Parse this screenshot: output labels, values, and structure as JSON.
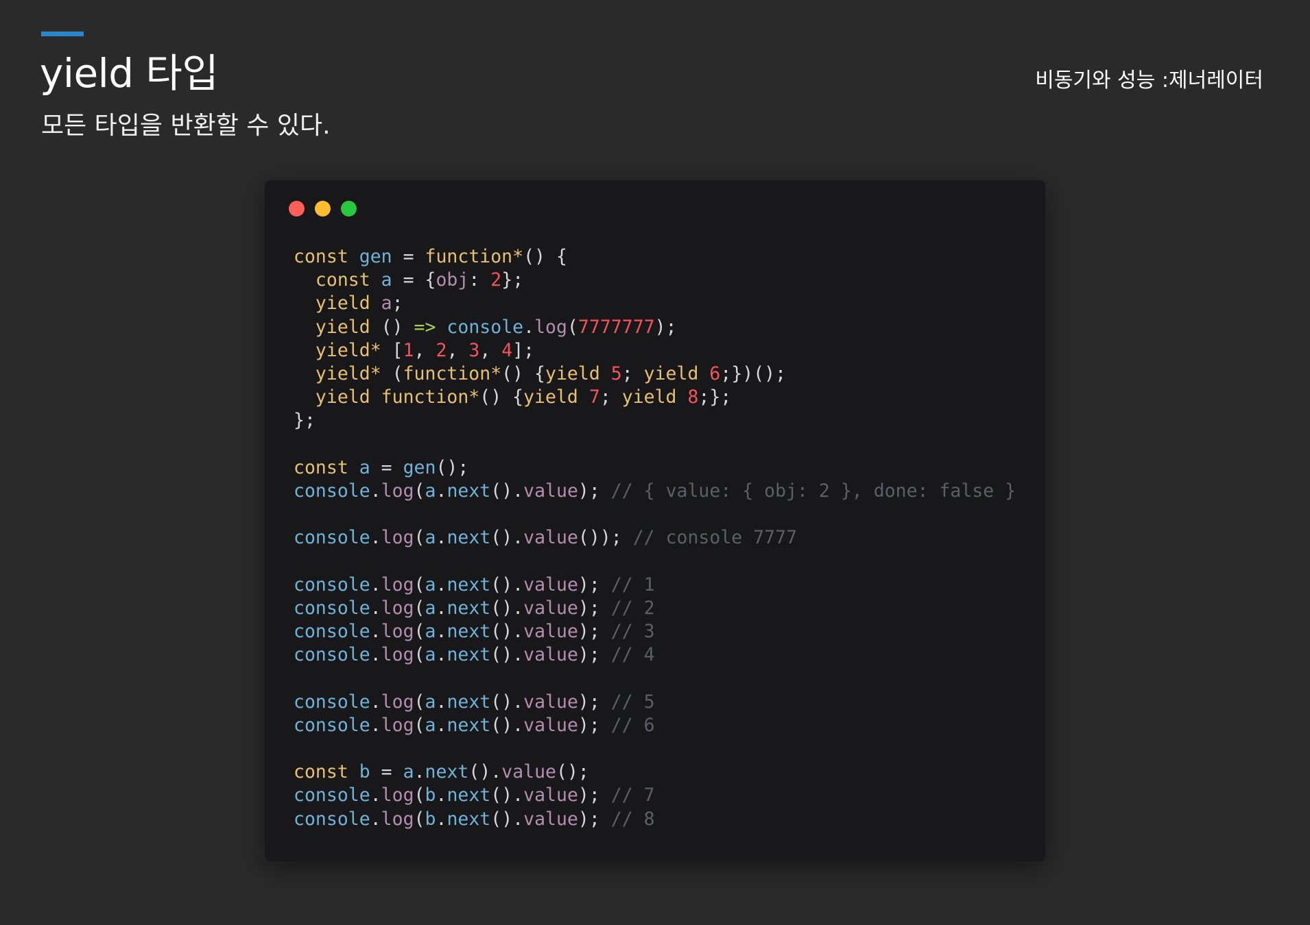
{
  "header": {
    "title": "yield 타입",
    "subtitle": "모든 타입을 반환할 수 있다.",
    "section": "비동기와 성능 :제너레이터"
  },
  "code_lines": [
    [
      [
        "kw",
        "const"
      ],
      [
        "pu",
        " "
      ],
      [
        "vr",
        "gen"
      ],
      [
        "pu",
        " = "
      ],
      [
        "kw",
        "function*"
      ],
      [
        "pu",
        "() {"
      ]
    ],
    [
      [
        "pu",
        "  "
      ],
      [
        "kw",
        "const"
      ],
      [
        "pu",
        " "
      ],
      [
        "vr",
        "a"
      ],
      [
        "pu",
        " = {"
      ],
      [
        "pr",
        "obj"
      ],
      [
        "pu",
        ": "
      ],
      [
        "nm",
        "2"
      ],
      [
        "pu",
        "};"
      ]
    ],
    [
      [
        "pu",
        "  "
      ],
      [
        "kw",
        "yield"
      ],
      [
        "pu",
        " "
      ],
      [
        "pr",
        "a"
      ],
      [
        "pu",
        ";"
      ]
    ],
    [
      [
        "pu",
        "  "
      ],
      [
        "kw",
        "yield"
      ],
      [
        "pu",
        " () "
      ],
      [
        "ar",
        "=>"
      ],
      [
        "pu",
        " "
      ],
      [
        "vr",
        "console"
      ],
      [
        "pu",
        "."
      ],
      [
        "pr",
        "log"
      ],
      [
        "pu",
        "("
      ],
      [
        "nm",
        "7777777"
      ],
      [
        "pu",
        ");"
      ]
    ],
    [
      [
        "pu",
        "  "
      ],
      [
        "kw",
        "yield*"
      ],
      [
        "pu",
        " ["
      ],
      [
        "nm",
        "1"
      ],
      [
        "pu",
        ", "
      ],
      [
        "nm",
        "2"
      ],
      [
        "pu",
        ", "
      ],
      [
        "nm",
        "3"
      ],
      [
        "pu",
        ", "
      ],
      [
        "nm",
        "4"
      ],
      [
        "pu",
        "];"
      ]
    ],
    [
      [
        "pu",
        "  "
      ],
      [
        "kw",
        "yield*"
      ],
      [
        "pu",
        " ("
      ],
      [
        "kw",
        "function*"
      ],
      [
        "pu",
        "() {"
      ],
      [
        "kw",
        "yield"
      ],
      [
        "pu",
        " "
      ],
      [
        "nm",
        "5"
      ],
      [
        "pu",
        "; "
      ],
      [
        "kw",
        "yield"
      ],
      [
        "pu",
        " "
      ],
      [
        "nm",
        "6"
      ],
      [
        "pu",
        ";})();"
      ]
    ],
    [
      [
        "pu",
        "  "
      ],
      [
        "kw",
        "yield"
      ],
      [
        "pu",
        " "
      ],
      [
        "kw",
        "function*"
      ],
      [
        "pu",
        "() {"
      ],
      [
        "kw",
        "yield"
      ],
      [
        "pu",
        " "
      ],
      [
        "nm",
        "7"
      ],
      [
        "pu",
        "; "
      ],
      [
        "kw",
        "yield"
      ],
      [
        "pu",
        " "
      ],
      [
        "nm",
        "8"
      ],
      [
        "pu",
        ";};"
      ]
    ],
    [
      [
        "pu",
        "};"
      ]
    ],
    [],
    [
      [
        "kw",
        "const"
      ],
      [
        "pu",
        " "
      ],
      [
        "vr",
        "a"
      ],
      [
        "pu",
        " = "
      ],
      [
        "vr",
        "gen"
      ],
      [
        "pu",
        "();"
      ]
    ],
    [
      [
        "vr",
        "console"
      ],
      [
        "pu",
        "."
      ],
      [
        "pr",
        "log"
      ],
      [
        "pu",
        "("
      ],
      [
        "vr",
        "a"
      ],
      [
        "pu",
        "."
      ],
      [
        "vr",
        "next"
      ],
      [
        "pu",
        "()."
      ],
      [
        "pr",
        "value"
      ],
      [
        "pu",
        "); "
      ],
      [
        "cm",
        "// { value: { obj: 2 }, done: false }"
      ]
    ],
    [],
    [
      [
        "vr",
        "console"
      ],
      [
        "pu",
        "."
      ],
      [
        "pr",
        "log"
      ],
      [
        "pu",
        "("
      ],
      [
        "vr",
        "a"
      ],
      [
        "pu",
        "."
      ],
      [
        "vr",
        "next"
      ],
      [
        "pu",
        "()."
      ],
      [
        "pr",
        "value"
      ],
      [
        "pu",
        "()); "
      ],
      [
        "cm",
        "// console 7777"
      ]
    ],
    [],
    [
      [
        "vr",
        "console"
      ],
      [
        "pu",
        "."
      ],
      [
        "pr",
        "log"
      ],
      [
        "pu",
        "("
      ],
      [
        "vr",
        "a"
      ],
      [
        "pu",
        "."
      ],
      [
        "vr",
        "next"
      ],
      [
        "pu",
        "()."
      ],
      [
        "pr",
        "value"
      ],
      [
        "pu",
        "); "
      ],
      [
        "cm",
        "// 1"
      ]
    ],
    [
      [
        "vr",
        "console"
      ],
      [
        "pu",
        "."
      ],
      [
        "pr",
        "log"
      ],
      [
        "pu",
        "("
      ],
      [
        "vr",
        "a"
      ],
      [
        "pu",
        "."
      ],
      [
        "vr",
        "next"
      ],
      [
        "pu",
        "()."
      ],
      [
        "pr",
        "value"
      ],
      [
        "pu",
        "); "
      ],
      [
        "cm",
        "// 2"
      ]
    ],
    [
      [
        "vr",
        "console"
      ],
      [
        "pu",
        "."
      ],
      [
        "pr",
        "log"
      ],
      [
        "pu",
        "("
      ],
      [
        "vr",
        "a"
      ],
      [
        "pu",
        "."
      ],
      [
        "vr",
        "next"
      ],
      [
        "pu",
        "()."
      ],
      [
        "pr",
        "value"
      ],
      [
        "pu",
        "); "
      ],
      [
        "cm",
        "// 3"
      ]
    ],
    [
      [
        "vr",
        "console"
      ],
      [
        "pu",
        "."
      ],
      [
        "pr",
        "log"
      ],
      [
        "pu",
        "("
      ],
      [
        "vr",
        "a"
      ],
      [
        "pu",
        "."
      ],
      [
        "vr",
        "next"
      ],
      [
        "pu",
        "()."
      ],
      [
        "pr",
        "value"
      ],
      [
        "pu",
        "); "
      ],
      [
        "cm",
        "// 4"
      ]
    ],
    [],
    [
      [
        "vr",
        "console"
      ],
      [
        "pu",
        "."
      ],
      [
        "pr",
        "log"
      ],
      [
        "pu",
        "("
      ],
      [
        "vr",
        "a"
      ],
      [
        "pu",
        "."
      ],
      [
        "vr",
        "next"
      ],
      [
        "pu",
        "()."
      ],
      [
        "pr",
        "value"
      ],
      [
        "pu",
        "); "
      ],
      [
        "cm",
        "// 5"
      ]
    ],
    [
      [
        "vr",
        "console"
      ],
      [
        "pu",
        "."
      ],
      [
        "pr",
        "log"
      ],
      [
        "pu",
        "("
      ],
      [
        "vr",
        "a"
      ],
      [
        "pu",
        "."
      ],
      [
        "vr",
        "next"
      ],
      [
        "pu",
        "()."
      ],
      [
        "pr",
        "value"
      ],
      [
        "pu",
        "); "
      ],
      [
        "cm",
        "// 6"
      ]
    ],
    [],
    [
      [
        "kw",
        "const"
      ],
      [
        "pu",
        " "
      ],
      [
        "vr",
        "b"
      ],
      [
        "pu",
        " = "
      ],
      [
        "vr",
        "a"
      ],
      [
        "pu",
        "."
      ],
      [
        "vr",
        "next"
      ],
      [
        "pu",
        "()."
      ],
      [
        "pr",
        "value"
      ],
      [
        "pu",
        "();"
      ]
    ],
    [
      [
        "vr",
        "console"
      ],
      [
        "pu",
        "."
      ],
      [
        "pr",
        "log"
      ],
      [
        "pu",
        "("
      ],
      [
        "vr",
        "b"
      ],
      [
        "pu",
        "."
      ],
      [
        "vr",
        "next"
      ],
      [
        "pu",
        "()."
      ],
      [
        "pr",
        "value"
      ],
      [
        "pu",
        "); "
      ],
      [
        "cm",
        "// 7"
      ]
    ],
    [
      [
        "vr",
        "console"
      ],
      [
        "pu",
        "."
      ],
      [
        "pr",
        "log"
      ],
      [
        "pu",
        "("
      ],
      [
        "vr",
        "b"
      ],
      [
        "pu",
        "."
      ],
      [
        "vr",
        "next"
      ],
      [
        "pu",
        "()."
      ],
      [
        "pr",
        "value"
      ],
      [
        "pu",
        "); "
      ],
      [
        "cm",
        "// 8"
      ]
    ]
  ],
  "colors": {
    "background": "#2a2a2b",
    "accent": "#2c86c9",
    "code_bg": "#18181a",
    "keyword": "#e8c071",
    "variable": "#6fb3d9",
    "number": "#f2545b",
    "property": "#b48ead",
    "comment": "#596068"
  }
}
